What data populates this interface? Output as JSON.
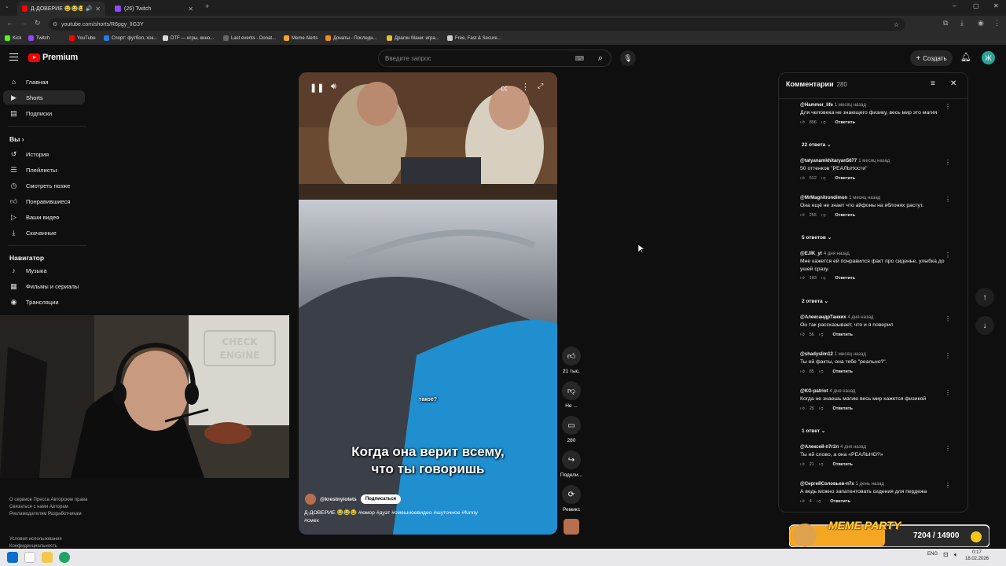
{
  "browser": {
    "tabs": [
      {
        "title": "Д-ДОВЕРИЕ 😂😂😂 #юм",
        "active": true
      },
      {
        "title": "(26) Twitch",
        "active": false
      }
    ],
    "url": "youtube.com/shorts/R6pgy_lIG3Y",
    "bookmarks": [
      "Kick",
      "Twitch",
      "YouTube",
      "Спорт: футбол, хок...",
      "DTF — игры, кино...",
      "Last events - Donat...",
      "Meme Alerts",
      "Донаты - Последн...",
      "Драгон Мани: игра...",
      "Free, Fast & Secure..."
    ]
  },
  "header": {
    "logo": "Premium",
    "search_placeholder": "Введите запрос",
    "create_label": "Создать",
    "avatar_letter": "Ж"
  },
  "sidebar": {
    "main": [
      {
        "label": "Главная",
        "icon": "home-icon"
      },
      {
        "label": "Shorts",
        "icon": "shorts-icon",
        "active": true
      },
      {
        "label": "Подписки",
        "icon": "subscriptions-icon"
      }
    ],
    "you_heading": "Вы",
    "you": [
      {
        "label": "История",
        "icon": "history-icon"
      },
      {
        "label": "Плейлисты",
        "icon": "playlists-icon"
      },
      {
        "label": "Смотреть позже",
        "icon": "watch-later-icon"
      },
      {
        "label": "Понравившиеся",
        "icon": "liked-icon"
      },
      {
        "label": "Ваши видео",
        "icon": "your-videos-icon"
      },
      {
        "label": "Скачанные",
        "icon": "downloads-icon"
      }
    ],
    "nav_heading": "Навигатор",
    "nav": [
      {
        "label": "Музыка",
        "icon": "music-icon"
      },
      {
        "label": "Фильмы и сериалы",
        "icon": "movies-icon"
      },
      {
        "label": "Трансляции",
        "icon": "live-icon"
      }
    ],
    "footer1": "О сервисе   Пресса   Авторские права   Связаться с нами   Авторам   Рекламодателям   Разработчикам",
    "footer2": "Условия использования   Конфиденциальность"
  },
  "video": {
    "caption_small": "такое?",
    "caption_line1": "Когда она верит всему,",
    "caption_line2": "что ты говоришь",
    "channel": "@krestnyiotets",
    "subscribe_label": "Подписаться",
    "description_line1": "Д-ДОВЕРИЕ 😂😂😂 #юмор #дуэт #смешноевидео #шуточное #funny",
    "description_line2": "#смех",
    "likes": "21 тыс.",
    "dislike_label": "Не ...",
    "comments_count": "280",
    "share_label": "Подели...",
    "remix_label": "Ремикс"
  },
  "comments": {
    "title": "Комментарии",
    "count": "280",
    "reply_label": "Ответить",
    "items": [
      {
        "author": "@Hammer_life",
        "time": "1 месяц назад",
        "text": "Для человека не знающего физику, весь мир это магия",
        "likes": "896"
      },
      {
        "author": "@tatyanamkhitaryan5677",
        "time": "1 месяц назад",
        "text": "50 оттенков \"РЕАЛЬНости\"",
        "likes": "512"
      },
      {
        "author": "@MrMagnitrondimon",
        "time": "1 месяц назад",
        "text": "Она ещё не знает что айфоны на яблонях растут.",
        "likes": "255"
      },
      {
        "author": "@EJIK_yt",
        "time": "4 дня назад",
        "text": "Мне кажется ей понравился факт про сиденье, улыбка до ушей сразу.",
        "likes": "183"
      },
      {
        "author": "@АлександрТанких",
        "time": "4 дня назад",
        "text": "Он так рассказывает, что и я поверил",
        "likes": "56"
      },
      {
        "author": "@shadyslim12",
        "time": "1 месяц назад",
        "text": "Ты ей факты, она тебе \"реально?\".",
        "likes": "85"
      },
      {
        "author": "@KG-patriot",
        "time": "4 дня назад",
        "text": "Когда не знаешь магию весь мир кажется физикой",
        "likes": "25"
      },
      {
        "author": "@Алексей-п7г2л",
        "time": "4 дня назад",
        "text": "Ты ей слово, а она «РЕАЛЬНО?»",
        "likes": "21"
      },
      {
        "author": "@СергейСоловьев-п7х",
        "time": "1 день назад",
        "text": "А ведь можно запатентовать сидения для пердежа",
        "likes": "4"
      }
    ],
    "replies": [
      "22 ответа",
      "5 ответов",
      "2 ответа",
      "1 ответ"
    ]
  },
  "meme_party": {
    "title": "MEME PARTY",
    "progress": "7204 / 14900",
    "progress_fraction": 0.48
  },
  "webcam": {
    "sign_line1": "CHECK",
    "sign_line2": "ENGINE"
  },
  "taskbar": {
    "lang": "ENG",
    "time": "0:17",
    "date": "18.02.2026"
  }
}
